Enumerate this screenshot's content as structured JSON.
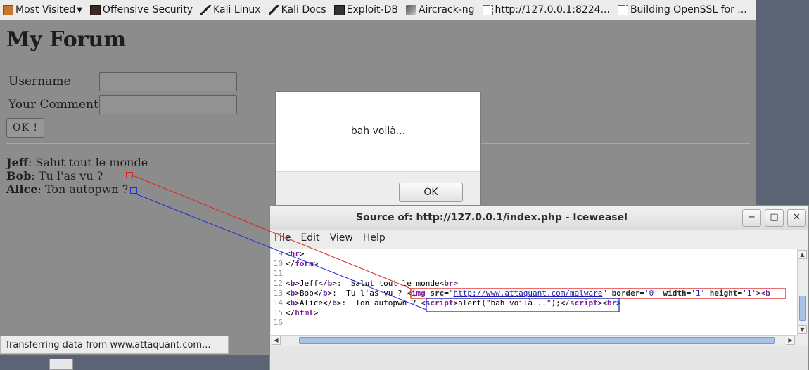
{
  "bookmarks": [
    {
      "label": "Most Visited",
      "icon": "orange"
    },
    {
      "label": "Offensive Security",
      "icon": "dark"
    },
    {
      "label": "Kali Linux",
      "icon": "dragon"
    },
    {
      "label": "Kali Docs",
      "icon": "dragon"
    },
    {
      "label": "Exploit-DB",
      "icon": "exploit"
    },
    {
      "label": "Aircrack-ng",
      "icon": "aircrack"
    },
    {
      "label": "http://127.0.0.1:8224...",
      "icon": "blank"
    },
    {
      "label": "Building OpenSSL for ...",
      "icon": "blank"
    }
  ],
  "page": {
    "title": "My Forum",
    "username_label": "Username",
    "comment_label": "Your Comment",
    "ok_label": "OK !",
    "posts": [
      {
        "author": "Jeff",
        "text": ": Salut tout le monde"
      },
      {
        "author": "Bob",
        "text": ": Tu l'as vu ?"
      },
      {
        "author": "Alice",
        "text": ": Ton autopwn ?"
      }
    ]
  },
  "status": "Transferring data from www.attaquant.com...",
  "alert": {
    "message": "bah voilà...",
    "ok_label": "OK"
  },
  "source_window": {
    "title": "Source of: http://127.0.0.1/index.php - Iceweasel",
    "menus": [
      "File",
      "Edit",
      "View",
      "Help"
    ],
    "minimize": "−",
    "maximize": "□",
    "close": "✕",
    "lines": {
      "l9": "9",
      "l10": "10",
      "l11": "11",
      "l12": "12",
      "l13": "13",
      "l14": "14",
      "l15": "15",
      "l16": "16",
      "jeff_text": "Jeff",
      "jeff_msg": ":  Salut tout le monde",
      "bob_text": "Bob",
      "bob_msg": ":  Tu l'as vu ? ",
      "bob_img_url": "http://www.attaquant.com/malware",
      "alice_text": "Alice",
      "alice_msg": ":  Ton autopwn ? ",
      "alice_script": "alert(\"bah voilà...\");"
    }
  },
  "colors": {
    "highlight_red": "#e02020",
    "highlight_blue": "#1f2fd6"
  }
}
